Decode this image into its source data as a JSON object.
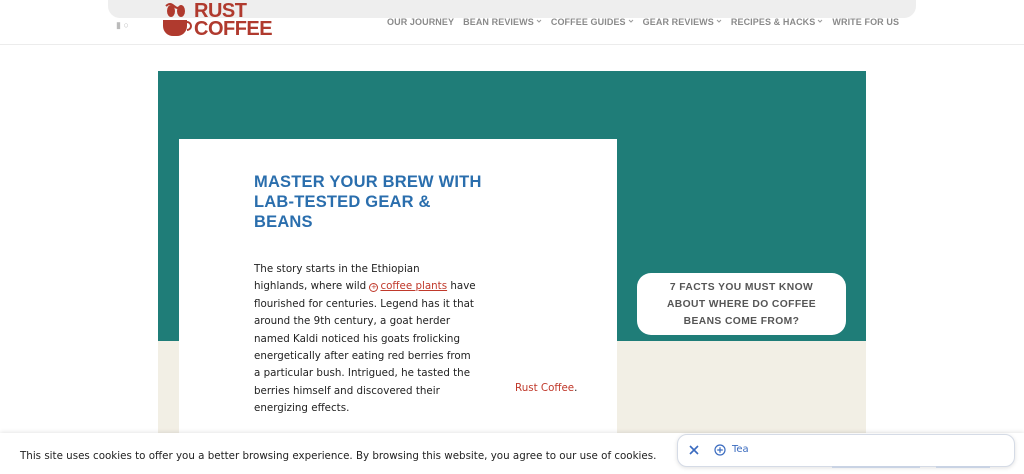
{
  "header": {
    "logo": {
      "line1": "RUST",
      "line2": "COFFEE",
      "icon": "coffee-cup-icon",
      "color": "#b03a2e"
    },
    "nav": [
      {
        "label": "OUR JOURNEY",
        "has_dropdown": false
      },
      {
        "label": "BEAN REVIEWS",
        "has_dropdown": true
      },
      {
        "label": "COFFEE GUIDES",
        "has_dropdown": true
      },
      {
        "label": "GEAR REVIEWS",
        "has_dropdown": true
      },
      {
        "label": "RECIPES & HACKS",
        "has_dropdown": true
      },
      {
        "label": "WRITE FOR US",
        "has_dropdown": false
      }
    ]
  },
  "hero": {
    "title": "MASTER YOUR BREW WITH LAB-TESTED GEAR & BEANS",
    "body_before_link": "The story starts in the Ethiopian highlands, where wild ",
    "body_link": "coffee plants",
    "body_after_link": " have flourished for centuries. Legend has it that around the 9th century, a goat herder named Kaldi noticed his goats frolicking energetically after eating red berries from a particular bush. Intrigued, he tasted the berries himself and discovered their energizing effects.",
    "brand_link": "Rust Coffee",
    "brand_link_suffix": ".",
    "facts_button": "7 FACTS YOU MUST KNOW ABOUT WHERE DO COFFEE BEANS COME FROM?",
    "colors": {
      "teal": "#1f7d78",
      "cream": "#f2efe5",
      "title": "#2a6ead",
      "link": "#c0392b"
    }
  },
  "cookie_bar": {
    "text": "This site uses cookies to offer you a better browsing experience. By browsing this website, you agree to our use of cookies."
  },
  "tea_widget": {
    "label": "Tea",
    "close_icon": "close-icon",
    "add_icon": "plus-circle-icon"
  }
}
